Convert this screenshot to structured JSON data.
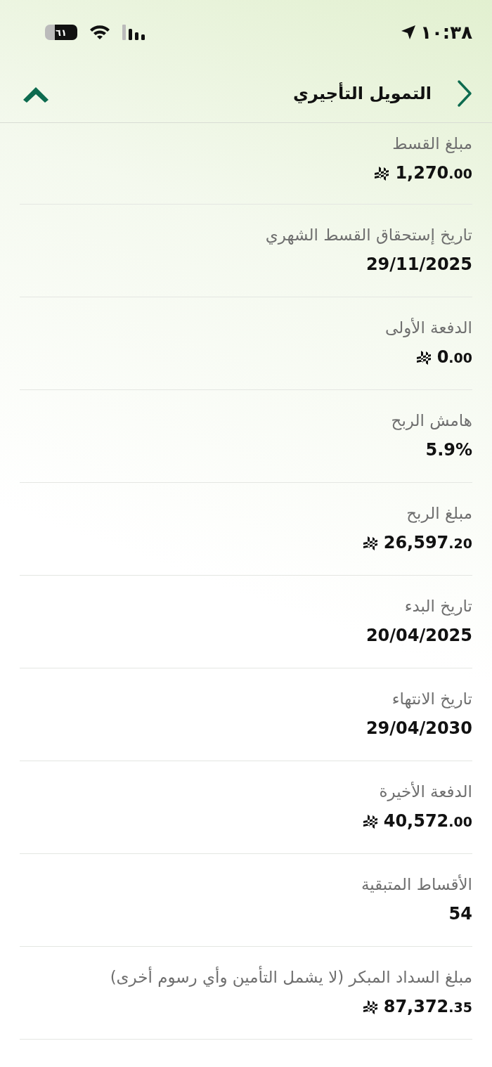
{
  "status_bar": {
    "time": "١٠:٣٨",
    "battery": "٦١"
  },
  "header": {
    "title": "التمويل التأجيري"
  },
  "rows": [
    {
      "label": "مبلغ القسط",
      "kind": "money",
      "whole": "1,270",
      "cents": ".00"
    },
    {
      "label": "تاريخ إستحقاق القسط الشهري",
      "kind": "text",
      "value": "29/11/2025"
    },
    {
      "label": "الدفعة الأولى",
      "kind": "money",
      "whole": "0",
      "cents": ".00"
    },
    {
      "label": "هامش الربح",
      "kind": "text",
      "value": "5.9%"
    },
    {
      "label": "مبلغ الربح",
      "kind": "money",
      "whole": "26,597",
      "cents": ".20"
    },
    {
      "label": "تاريخ البدء",
      "kind": "text",
      "value": "20/04/2025"
    },
    {
      "label": "تاريخ الانتهاء",
      "kind": "text",
      "value": "29/04/2030"
    },
    {
      "label": "الدفعة الأخيرة",
      "kind": "money",
      "whole": "40,572",
      "cents": ".00"
    },
    {
      "label": "الأقساط المتبقية",
      "kind": "text",
      "value": "54"
    },
    {
      "label": "مبلغ السداد المبكر (لا يشمل التأمين وأي رسوم أخرى)",
      "kind": "money",
      "whole": "87,372",
      "cents": ".35"
    }
  ]
}
